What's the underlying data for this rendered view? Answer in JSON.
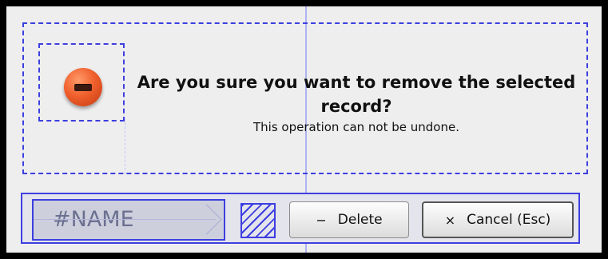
{
  "dialog": {
    "title": "Are you sure you want to remove the selected record?",
    "message": "This operation can not be undone.",
    "icon": "remove-icon"
  },
  "footer": {
    "name_field_value": "#NAME",
    "delete_icon": "−",
    "delete_label": "Delete",
    "cancel_icon": "×",
    "cancel_label": "Cancel (Esc)"
  },
  "colors": {
    "guide": "#3d3fe0",
    "icon_red": "#f0602d",
    "dialog_bg": "#eeeeee"
  }
}
